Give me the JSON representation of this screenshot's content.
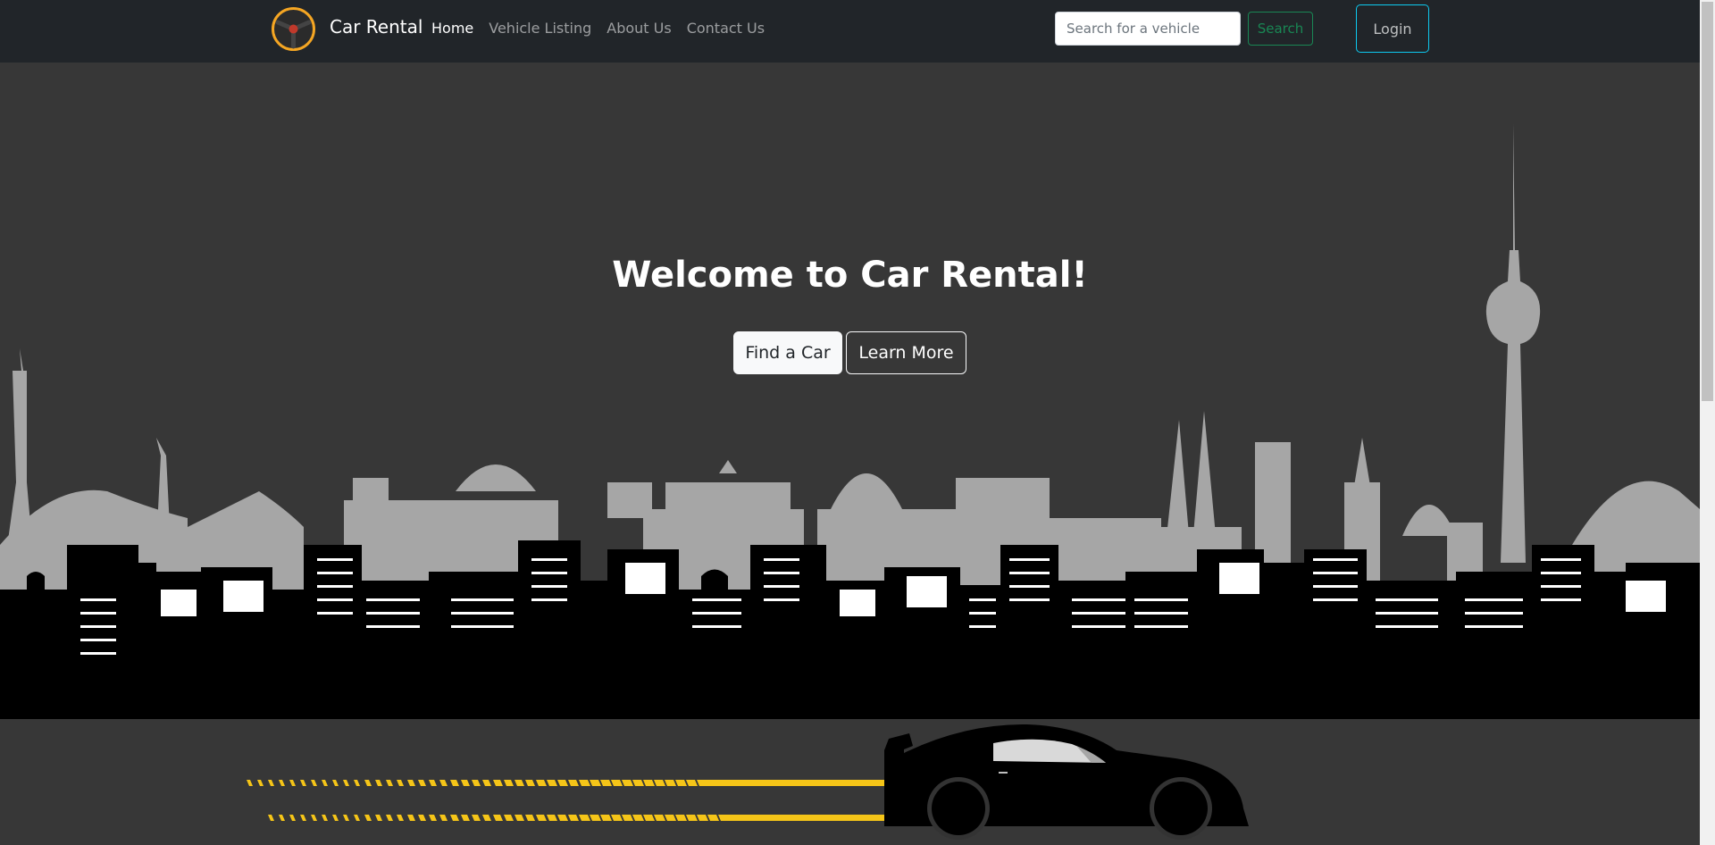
{
  "navbar": {
    "brand": "Car Rental",
    "links": [
      {
        "label": "Home",
        "active": true
      },
      {
        "label": "Vehicle Listing",
        "active": false
      },
      {
        "label": "About Us",
        "active": false
      },
      {
        "label": "Contact Us",
        "active": false
      }
    ],
    "search": {
      "placeholder": "Search for a vehicle",
      "value": ""
    },
    "search_button": "Search",
    "login_button": "Login"
  },
  "hero": {
    "title": "Welcome to Car Rental!",
    "primary_button": "Find a Car",
    "secondary_button": "Learn More"
  },
  "colors": {
    "navbar_bg": "#212529",
    "hero_bg": "#373737",
    "skyline_far": "#a6a6a6",
    "skyline_near": "#000000",
    "logo_ring": "#f5a623",
    "road_stripes": "#f5c518",
    "search_button": "#198754",
    "login_border": "#0dcaf0"
  },
  "icons": {
    "logo": "steering-wheel-icon",
    "car": "sports-car-silhouette"
  }
}
